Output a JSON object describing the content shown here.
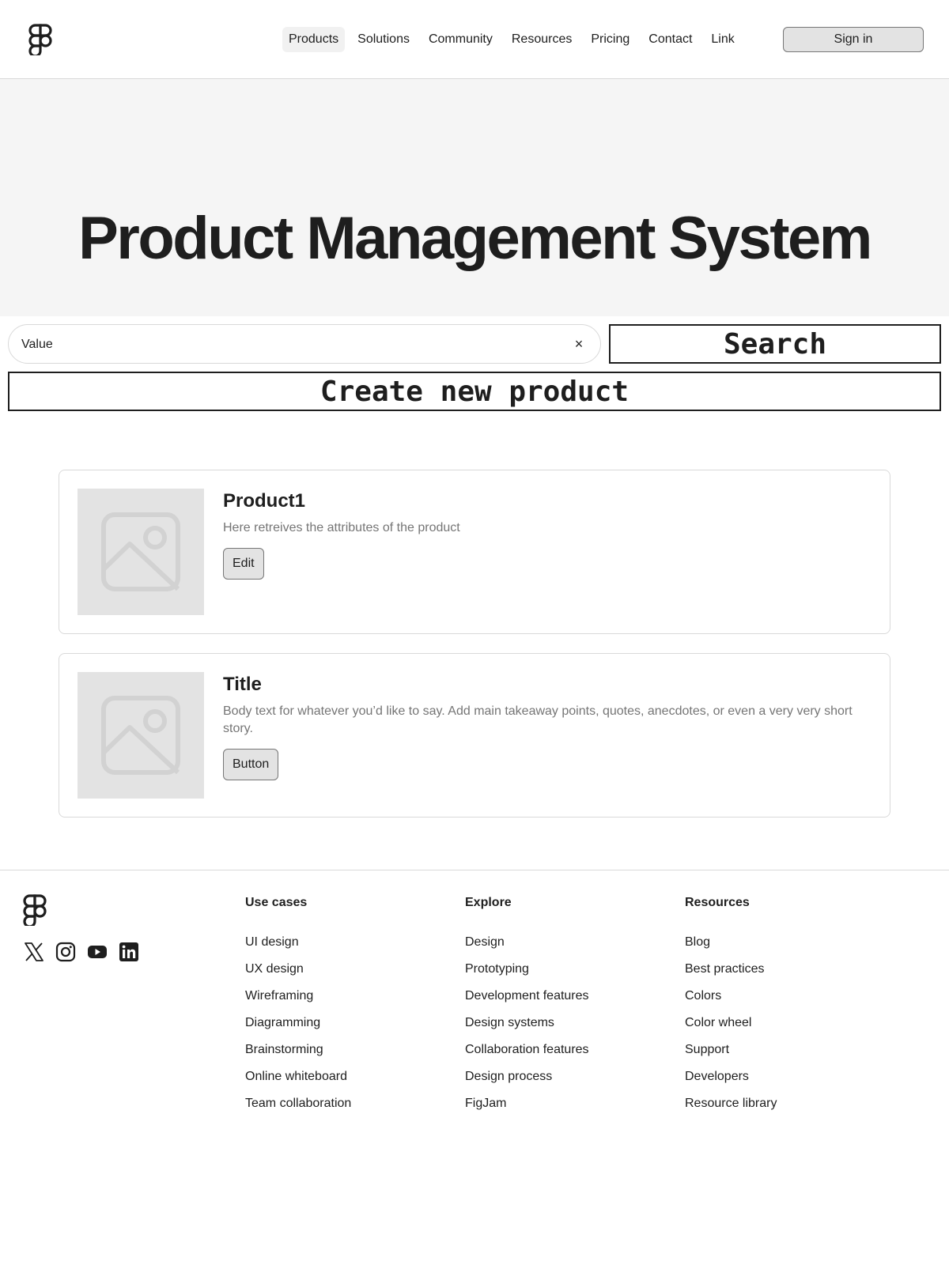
{
  "header": {
    "nav": [
      "Products",
      "Solutions",
      "Community",
      "Resources",
      "Pricing",
      "Contact",
      "Link"
    ],
    "signin_label": "Sign in"
  },
  "hero": {
    "title": "Product Management System"
  },
  "search": {
    "value": "Value",
    "clear_icon": "×",
    "button_label": "Search"
  },
  "create_button_label": "Create new product",
  "cards": [
    {
      "title": "Product1",
      "body": "Here retreives the attributes of the product",
      "button": "Edit"
    },
    {
      "title": "Title",
      "body": "Body text for whatever you’d like to say. Add main takeaway points, quotes, anecdotes, or even a very very short story.",
      "button": "Button"
    }
  ],
  "footer": {
    "socials": [
      "x-icon",
      "instagram-icon",
      "youtube-icon",
      "linkedin-icon"
    ],
    "columns": [
      {
        "title": "Use cases",
        "links": [
          "UI design",
          "UX design",
          "Wireframing",
          "Diagramming",
          "Brainstorming",
          "Online whiteboard",
          "Team collaboration"
        ]
      },
      {
        "title": "Explore",
        "links": [
          "Design",
          "Prototyping",
          "Development features",
          "Design systems",
          "Collaboration features",
          "Design process",
          "FigJam"
        ]
      },
      {
        "title": "Resources",
        "links": [
          "Blog",
          "Best practices",
          "Colors",
          "Color wheel",
          "Support",
          "Developers",
          "Resource library"
        ]
      }
    ]
  },
  "colors": {
    "text": "#1e1e1e",
    "muted": "#757575",
    "hero_bg": "#f5f5f5",
    "button_bg": "#e3e3e3",
    "border": "#d9d9d9"
  }
}
